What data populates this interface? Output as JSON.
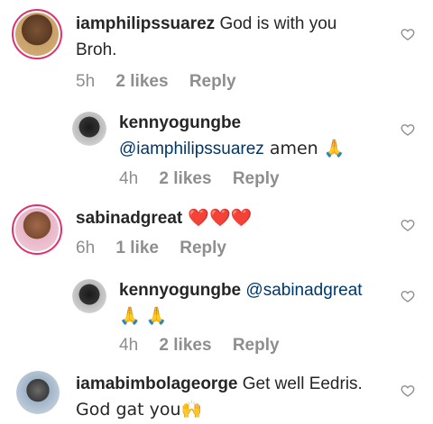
{
  "comments": [
    {
      "username": "iamphilipssuarez",
      "mention": "",
      "text_line1": " God is with you",
      "text_line2": "Broh.",
      "time": "5h",
      "likes": "2 likes",
      "reply": "Reply"
    },
    {
      "username": "kennyogungbe",
      "mention": "@iamphilipssuarez",
      "text_line1": " amen 🙏",
      "text_line2": "",
      "time": "4h",
      "likes": "2 likes",
      "reply": "Reply"
    },
    {
      "username": "sabinadgreat",
      "mention": "",
      "text_line1": " ❤️❤️❤️",
      "text_line2": "",
      "time": "6h",
      "likes": "1 like",
      "reply": "Reply"
    },
    {
      "username": "kennyogungbe",
      "mention": "@sabinadgreat",
      "text_line1": "",
      "text_line2": "🙏 🙏",
      "time": "4h",
      "likes": "2 likes",
      "reply": "Reply"
    },
    {
      "username": "iamabimbolageorge",
      "mention": "",
      "text_line1": " Get well Eedris.",
      "text_line2": "God gat you🙌",
      "time": "",
      "likes": "",
      "reply": ""
    }
  ],
  "icons": {
    "like": "heart-outline-icon",
    "avatar": "profile-avatar-icon"
  },
  "colors": {
    "username": "#262626",
    "mention": "#00376b",
    "meta": "#8e8e8e",
    "story_ring": "#e1306c"
  }
}
